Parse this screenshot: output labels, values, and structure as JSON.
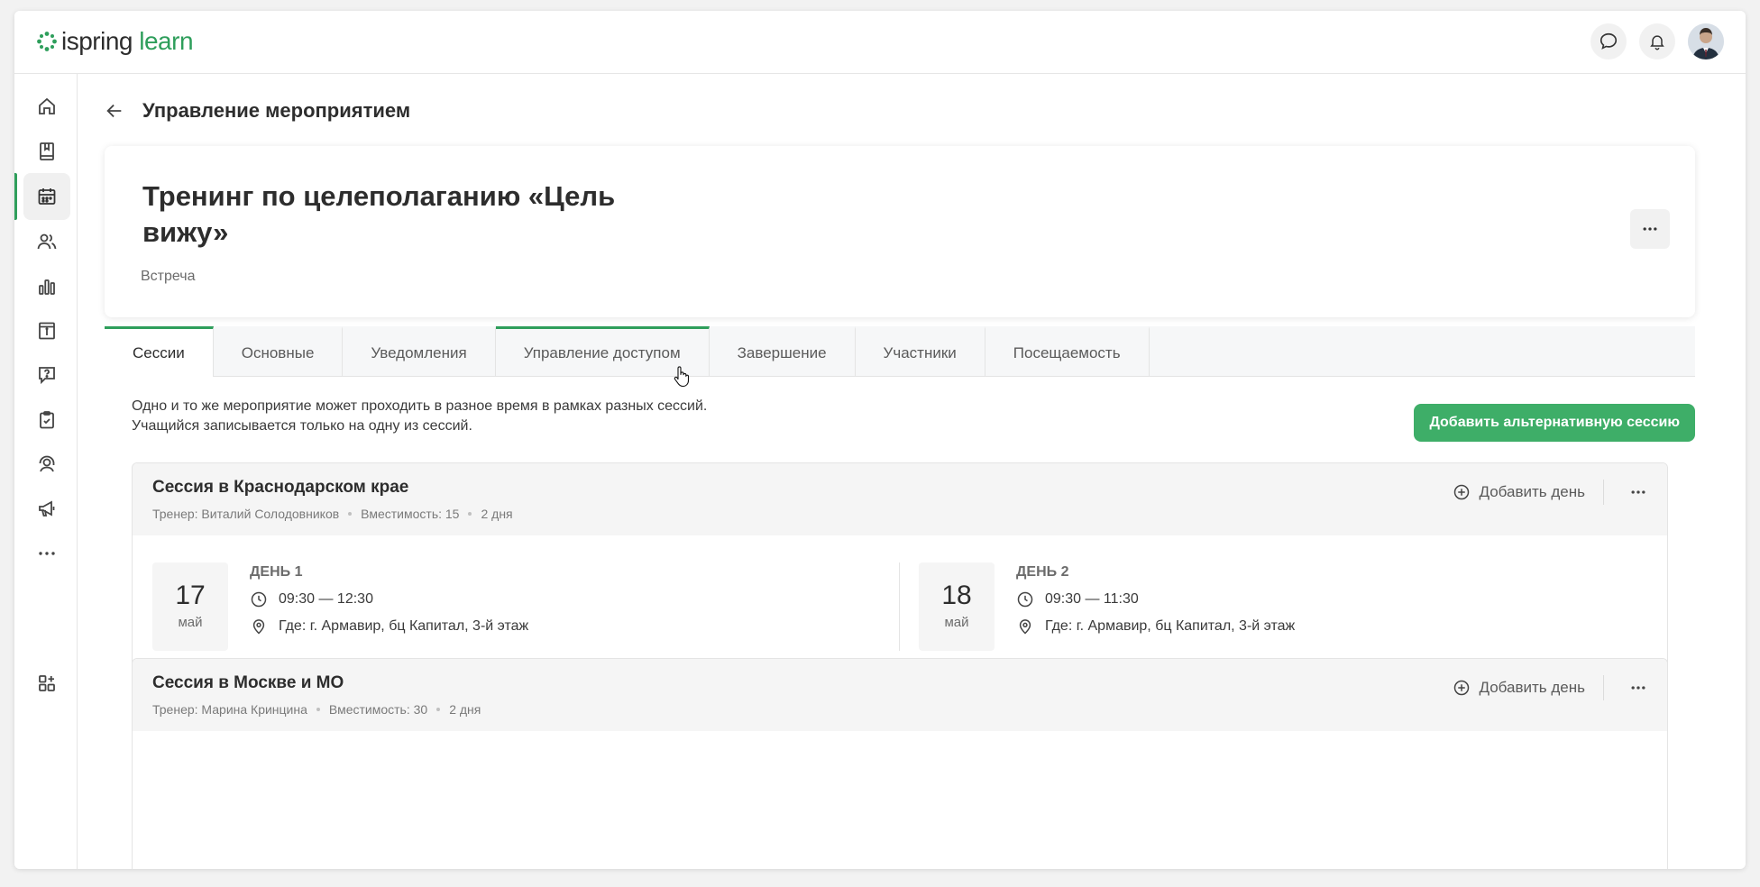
{
  "app": {
    "logo_left": "ispring",
    "logo_right": "learn",
    "accent": "#2e9e5b"
  },
  "topbar": {
    "icons": [
      "chat-icon",
      "bell-icon",
      "user-avatar"
    ]
  },
  "sidebar": {
    "items": [
      {
        "name": "home-icon"
      },
      {
        "name": "book-icon"
      },
      {
        "name": "calendar-icon",
        "active": true
      },
      {
        "name": "users-icon"
      },
      {
        "name": "chart-icon"
      },
      {
        "name": "info-panel-icon"
      },
      {
        "name": "question-icon"
      },
      {
        "name": "clipboard-check-icon"
      },
      {
        "name": "support-icon"
      },
      {
        "name": "megaphone-icon"
      },
      {
        "name": "more-icon"
      },
      {
        "name": "apps-add-icon"
      }
    ]
  },
  "page": {
    "title": "Управление мероприятием"
  },
  "event": {
    "title": "Тренинг по целеполаганию «Цель вижу»",
    "type": "Встреча"
  },
  "tabs": [
    {
      "label": "Сессии",
      "active": true
    },
    {
      "label": "Основные"
    },
    {
      "label": "Уведомления"
    },
    {
      "label": "Управление доступом",
      "hover": true
    },
    {
      "label": "Завершение"
    },
    {
      "label": "Участники"
    },
    {
      "label": "Посещаемость"
    }
  ],
  "sessions_tab": {
    "info_line1": "Одно и то же мероприятие может проходить в разное время в рамках разных сессий.",
    "info_line2": "Учащийся записывается только на одну из сессий.",
    "add_button": "Добавить альтернативную сессию"
  },
  "sessions": [
    {
      "name": "Сессия в Краснодарском крае",
      "trainer": "Тренер: Виталий Солодовников",
      "capacity": "Вместимость: 15",
      "duration": "2 дня",
      "add_day": "Добавить день",
      "days": [
        {
          "num": "17",
          "month": "май",
          "label": "ДЕНЬ 1",
          "time": "09:30 — 12:30",
          "place": "Где: г. Армавир, бц Капитал, 3-й этаж"
        },
        {
          "num": "18",
          "month": "май",
          "label": "ДЕНЬ 2",
          "time": "09:30 — 11:30",
          "place": "Где: г. Армавир, бц Капитал, 3-й этаж"
        }
      ]
    },
    {
      "name": "Сессия в Москве и МО",
      "trainer": "Тренер: Марина Кринцина",
      "capacity": "Вместимость: 30",
      "duration": "2 дня",
      "add_day": "Добавить день"
    }
  ]
}
